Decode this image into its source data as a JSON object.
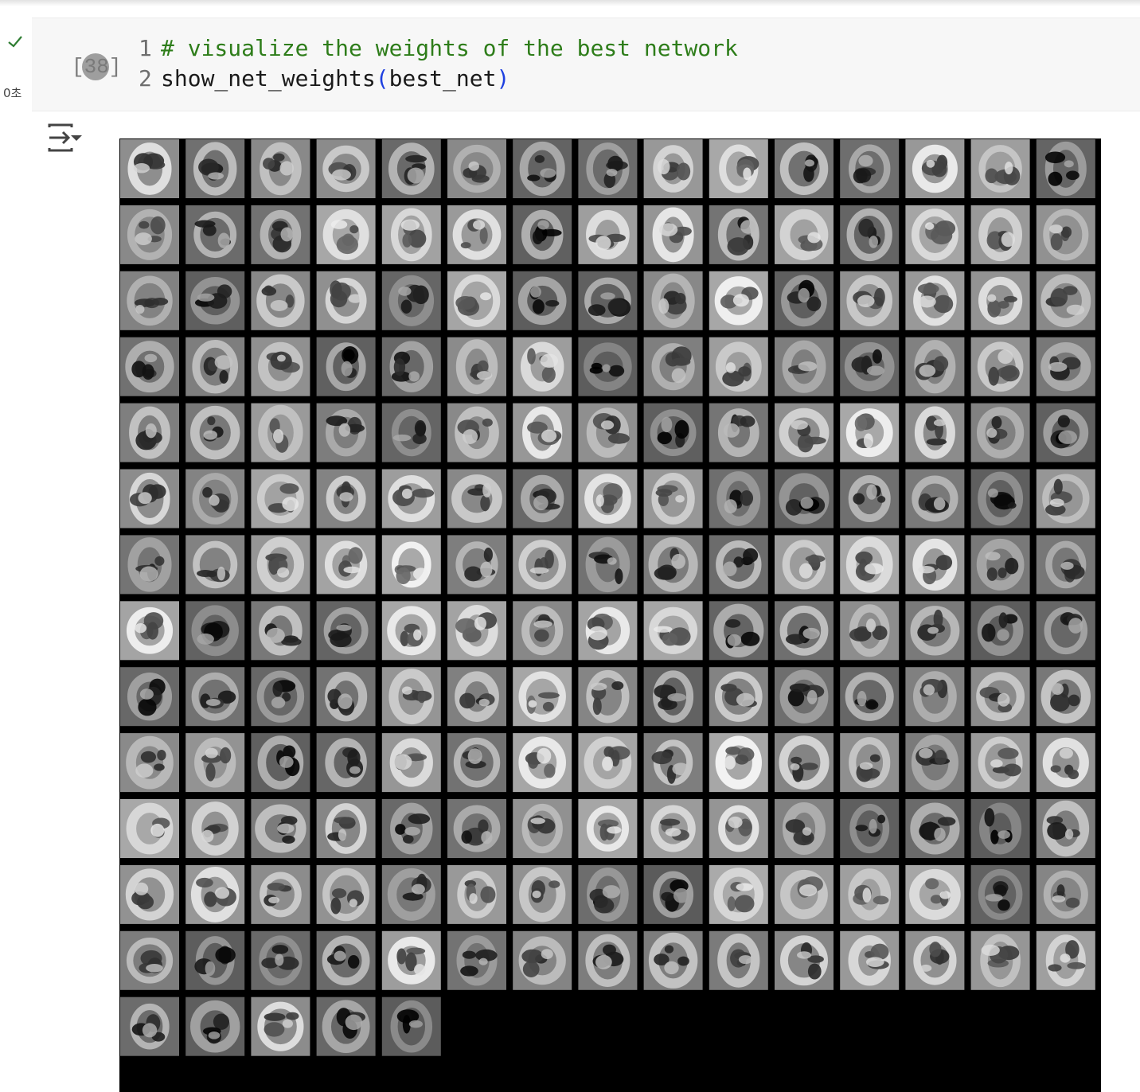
{
  "cell": {
    "execution_count": "[38]",
    "status_icon": "check-icon",
    "execution_time": "0초",
    "code_lines": [
      {
        "number": "1",
        "comment": "# visualize the weights of the best network"
      },
      {
        "number": "2",
        "func": "show_net_weights",
        "open_paren": "(",
        "arg": "best_net",
        "close_paren": ")"
      }
    ]
  },
  "output": {
    "toggle_icon": "output-collapse-icon",
    "image": {
      "content": "grid of hidden-layer weight visualizations",
      "columns": 15,
      "filled_rows": 13,
      "last_row_tiles": 5,
      "background": "#000000"
    }
  },
  "colors": {
    "comment": "#2e7d1a",
    "paren": "#1e40e0",
    "check": "#2e7d32",
    "cell_bg": "#f7f7f7"
  }
}
